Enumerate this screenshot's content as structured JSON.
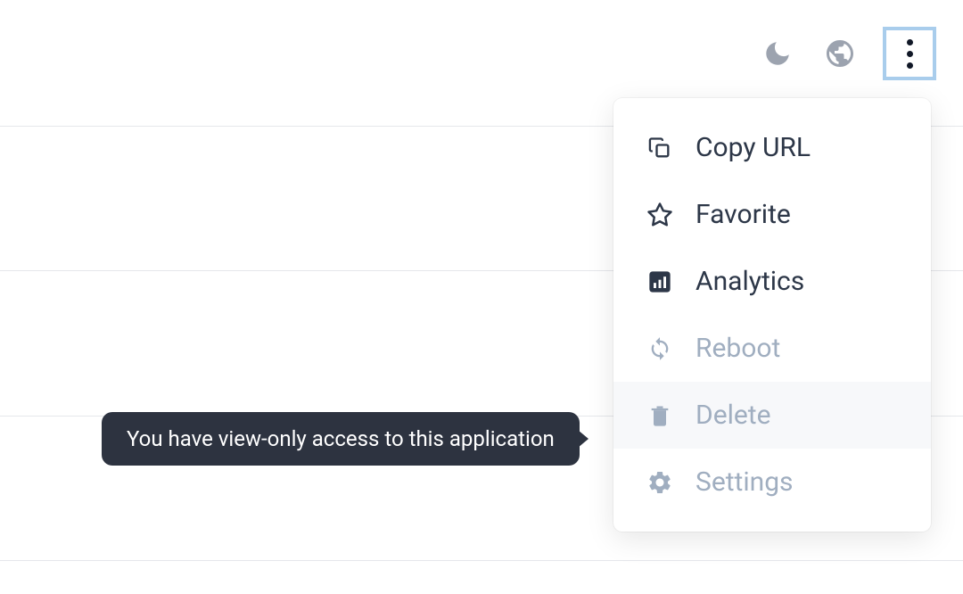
{
  "topbar": {
    "moon_icon": "moon-icon",
    "globe_icon": "globe-icon",
    "more_icon": "more-vertical-icon"
  },
  "dropdown": {
    "items": [
      {
        "label": "Copy URL",
        "icon": "copy-icon",
        "enabled": true,
        "hovered": false
      },
      {
        "label": "Favorite",
        "icon": "star-icon",
        "enabled": true,
        "hovered": false
      },
      {
        "label": "Analytics",
        "icon": "analytics-icon",
        "enabled": true,
        "hovered": false
      },
      {
        "label": "Reboot",
        "icon": "refresh-icon",
        "enabled": false,
        "hovered": false
      },
      {
        "label": "Delete",
        "icon": "trash-icon",
        "enabled": false,
        "hovered": true
      },
      {
        "label": "Settings",
        "icon": "gear-icon",
        "enabled": false,
        "hovered": false
      }
    ]
  },
  "tooltip": {
    "text": "You have view-only access to this application"
  }
}
